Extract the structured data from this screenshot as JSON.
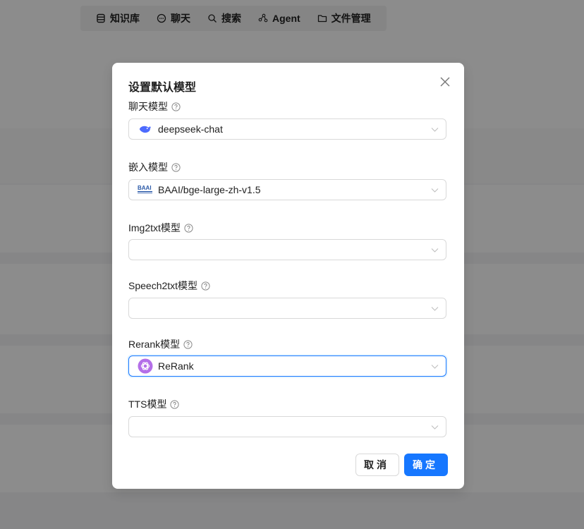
{
  "nav": {
    "items": [
      {
        "label": "知识库",
        "icon": "database-icon"
      },
      {
        "label": "聊天",
        "icon": "chat-icon"
      },
      {
        "label": "搜索",
        "icon": "search-icon"
      },
      {
        "label": "Agent",
        "icon": "agent-graph-icon"
      },
      {
        "label": "文件管理",
        "icon": "folder-icon"
      }
    ]
  },
  "modal": {
    "title": "设置默认模型",
    "fields": [
      {
        "label": "聊天模型",
        "value": "deepseek-chat",
        "logo": "deepseek-whale-logo"
      },
      {
        "label": "嵌入模型",
        "value": "BAAI/bge-large-zh-v1.5",
        "logo": "baai-logo"
      },
      {
        "label": "Img2txt模型",
        "value": ""
      },
      {
        "label": "Speech2txt模型",
        "value": ""
      },
      {
        "label": "Rerank模型",
        "value": "ReRank",
        "logo": "openai-logo"
      },
      {
        "label": "TTS模型",
        "value": ""
      }
    ],
    "cancel_label": "取消",
    "ok_label": "确定"
  },
  "colors": {
    "primary": "#1677ff",
    "border": "#d9d9d9",
    "overlay": "rgba(0,0,0,0.45)"
  }
}
